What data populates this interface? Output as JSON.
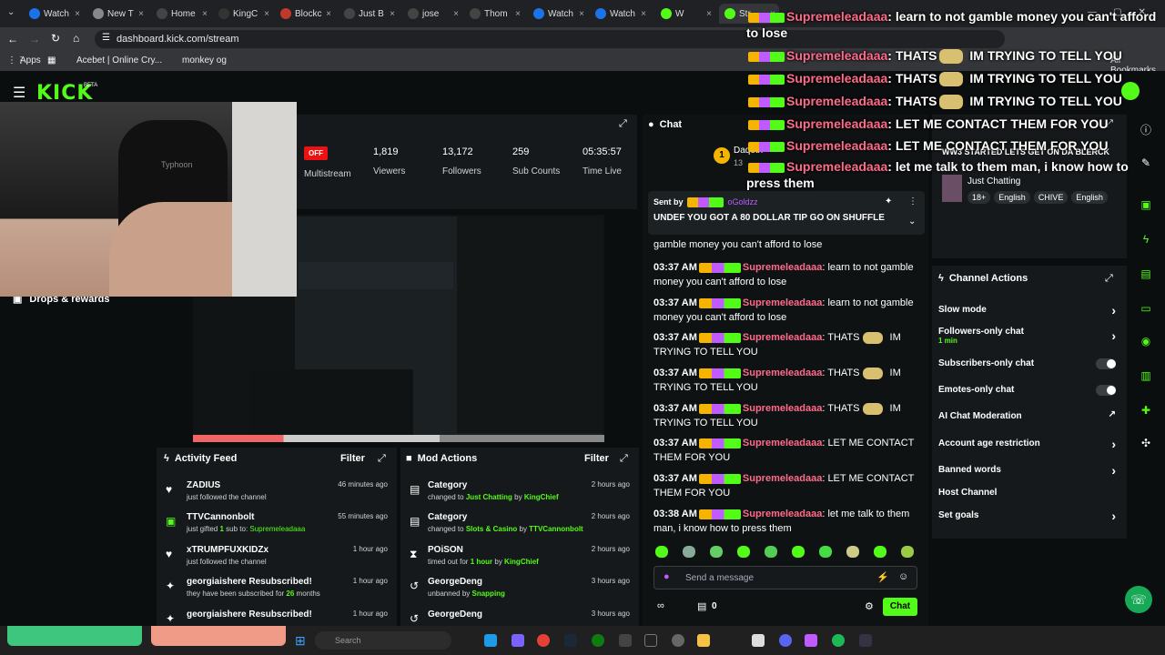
{
  "tabs": [
    {
      "label": "Watch",
      "color": "#1a73e8"
    },
    {
      "label": "New T",
      "color": "#888888"
    },
    {
      "label": "Home",
      "color": "#444444"
    },
    {
      "label": "KingC",
      "color": "#333333"
    },
    {
      "label": "Blockc",
      "color": "#c0392b"
    },
    {
      "label": "Just B",
      "color": "#444444"
    },
    {
      "label": "jose",
      "color": "#444444"
    },
    {
      "label": "Thom",
      "color": "#444444"
    },
    {
      "label": "Watch",
      "color": "#1a73e8"
    },
    {
      "label": "Watch",
      "color": "#1a73e8"
    },
    {
      "label": "W",
      "color": "#53fc18"
    },
    {
      "label": "Str",
      "color": "#53fc18"
    }
  ],
  "browser": {
    "url": "dashboard.kick.com/stream",
    "bookmarks": {
      "apps": "Apps",
      "acebet": "Acebet | Online Cry...",
      "monkey": "monkey og",
      "all": "All Bookmarks"
    }
  },
  "kick": {
    "logo": "KICK",
    "beta": "BETA"
  },
  "stream": {
    "status": "OFF",
    "multistream": "Multistream",
    "stats": [
      {
        "value": "1,819",
        "label": "Viewers"
      },
      {
        "value": "13,172",
        "label": "Followers"
      },
      {
        "value": "259",
        "label": "Sub Counts"
      },
      {
        "value": "05:35:57",
        "label": "Time Live"
      }
    ],
    "webcam_label": "Typhoon",
    "drops": "Drops & rewards"
  },
  "chat": {
    "title": "Chat",
    "viewer_badge": "1",
    "viewer_name": "Daqeth",
    "viewer_sub": "13",
    "pinned_sent_by": "Sent by",
    "pinned_user": "oGoldzz",
    "pinned_msg": "UNDEF YOU GOT A 80 DOLLAR TIP GO ON SHUFFLE",
    "partial_top": "gamble money you can't afford to lose",
    "messages": [
      {
        "time": "03:37 AM",
        "user": "Supremeleadaaa",
        "text": ": learn to not gamble money you can't afford to lose",
        "emote": false
      },
      {
        "time": "03:37 AM",
        "user": "Supremeleadaaa",
        "text": ": learn to not gamble money you can't afford to lose",
        "emote": false
      },
      {
        "time": "03:37 AM",
        "user": "Supremeleadaaa",
        "text": ": THATS",
        "after": " IM TRYING TO TELL YOU",
        "emote": true
      },
      {
        "time": "03:37 AM",
        "user": "Supremeleadaaa",
        "text": ": THATS",
        "after": " IM TRYING TO TELL YOU",
        "emote": true
      },
      {
        "time": "03:37 AM",
        "user": "Supremeleadaaa",
        "text": ": THATS",
        "after": " IM TRYING TO TELL YOU",
        "emote": true
      },
      {
        "time": "03:37 AM",
        "user": "Supremeleadaaa",
        "text": ": LET ME CONTACT THEM FOR YOU",
        "emote": false
      },
      {
        "time": "03:37 AM",
        "user": "Supremeleadaaa",
        "text": ": LET ME CONTACT THEM FOR YOU",
        "emote": false
      },
      {
        "time": "03:38 AM",
        "user": "Supremeleadaaa",
        "text": ": let me talk to them man, i know how to press them",
        "emote": false
      }
    ],
    "placeholder": "Send a message",
    "points": "0",
    "send": "Chat"
  },
  "overlay": [
    {
      "user": "Supremeleadaaa",
      "text": ": learn to not gamble money you can't afford to lose"
    },
    {
      "user": "Supremeleadaaa",
      "text": ": THATS",
      "after": " IM TRYING TO TELL YOU"
    },
    {
      "user": "Supremeleadaaa",
      "text": ": THATS",
      "after": " IM TRYING TO TELL YOU"
    },
    {
      "user": "Supremeleadaaa",
      "text": ": THATS",
      "after": " IM TRYING TO TELL YOU"
    },
    {
      "user": "Supremeleadaaa",
      "text": ": LET ME CONTACT THEM FOR YOU"
    },
    {
      "user": "Supremeleadaaa",
      "text": ": LET ME CONTACT THEM FOR YOU"
    },
    {
      "user": "Supremeleadaaa",
      "text": ": let me talk to them man, i know how to press them"
    }
  ],
  "stream_info": {
    "title": "WW3 STARTED LETS GET ON DA BLERCK",
    "category": "Just Chatting",
    "tags": [
      "18+",
      "English",
      "CHIVE",
      "English"
    ]
  },
  "channel_actions": {
    "title": "Channel Actions",
    "slow_mode": "Slow mode",
    "followers_only": "Followers-only chat",
    "followers_only_sub": "1 min",
    "subscribers_only": "Subscribers-only chat",
    "emotes_only": "Emotes-only chat",
    "ai_mod": "AI Chat Moderation",
    "account_age": "Account age restriction",
    "banned_words": "Banned words",
    "host": "Host Channel",
    "goals": "Set goals"
  },
  "activity": {
    "title": "Activity Feed",
    "filter": "Filter",
    "items": [
      {
        "name": "ZADIUS",
        "sub": "just followed the channel",
        "ago": "46 minutes ago",
        "icon": "heart"
      },
      {
        "name": "TTVCannonbolt",
        "sub_pre": "just gifted ",
        "sub_num": "1",
        "sub_mid": " sub to: ",
        "sub_user": "Supremeleadaaa",
        "ago": "55 minutes ago",
        "icon": "gift"
      },
      {
        "name": "xTRUMPFUXKIDZx",
        "sub": "just followed the channel",
        "ago": "1 hour ago",
        "icon": "heart"
      },
      {
        "name": "georgiaishere Resubscribed!",
        "sub_pre": "they have been subscribed for ",
        "sub_num": "26",
        "sub_mid": " months",
        "ago": "1 hour ago",
        "icon": "star"
      },
      {
        "name": "georgiaishere Resubscribed!",
        "ago": "1 hour ago",
        "icon": "star"
      }
    ]
  },
  "mod": {
    "title": "Mod Actions",
    "filter": "Filter",
    "items": [
      {
        "name": "Category",
        "pre": "changed to ",
        "hl": "Just Chatting",
        "mid": " by ",
        "user": "KingChief",
        "ago": "2 hours ago"
      },
      {
        "name": "Category",
        "pre": "changed to ",
        "hl": "Slots & Casino",
        "mid": " by ",
        "user": "TTVCannonbolt",
        "ago": "2 hours ago"
      },
      {
        "name": "POiSON",
        "pre": "timed out for ",
        "hl": "1 hour",
        "mid": " by ",
        "user": "KingChief",
        "ago": "2 hours ago"
      },
      {
        "name": "GeorgeDeng",
        "pre": "unbanned by ",
        "hl": "",
        "mid": "",
        "user": "Snapping",
        "ago": "3 hours ago"
      },
      {
        "name": "GeorgeDeng",
        "ago": "3 hours ago"
      }
    ]
  },
  "taskbar": {
    "search": "Search"
  },
  "colors": {
    "kick_green": "#53fc18",
    "username_pink": "#ff6b8a",
    "panel": "#16191b"
  }
}
